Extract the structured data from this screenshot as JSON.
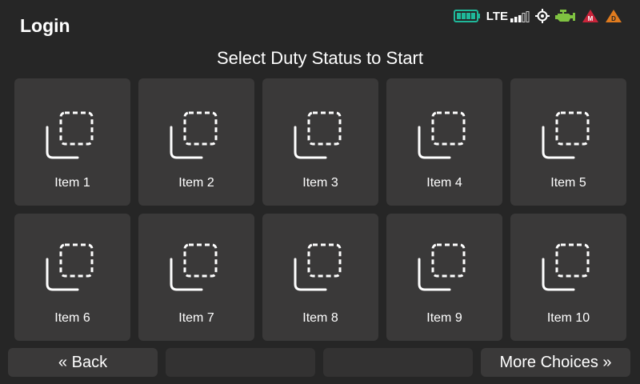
{
  "header": {
    "title": "Login",
    "subtitle": "Select Duty Status to Start"
  },
  "status": {
    "network": "LTE",
    "icons": [
      "battery-icon",
      "lte-signal-icon",
      "gps-icon",
      "engine-icon",
      "malfunction-warning-icon",
      "diagnostic-warning-icon"
    ],
    "warning_m": "M",
    "warning_d": "D",
    "colors": {
      "battery": "#1fb89a",
      "engine": "#7fc241",
      "malfunction": "#c8243a",
      "diagnostic": "#e07b1e"
    }
  },
  "items": [
    {
      "label": "Item 1"
    },
    {
      "label": "Item 2"
    },
    {
      "label": "Item 3"
    },
    {
      "label": "Item 4"
    },
    {
      "label": "Item 5"
    },
    {
      "label": "Item 6"
    },
    {
      "label": "Item 7"
    },
    {
      "label": "Item 8"
    },
    {
      "label": "Item 9"
    },
    {
      "label": "Item 10"
    }
  ],
  "footer": {
    "back_label": "« Back",
    "more_label": "More Choices »"
  }
}
